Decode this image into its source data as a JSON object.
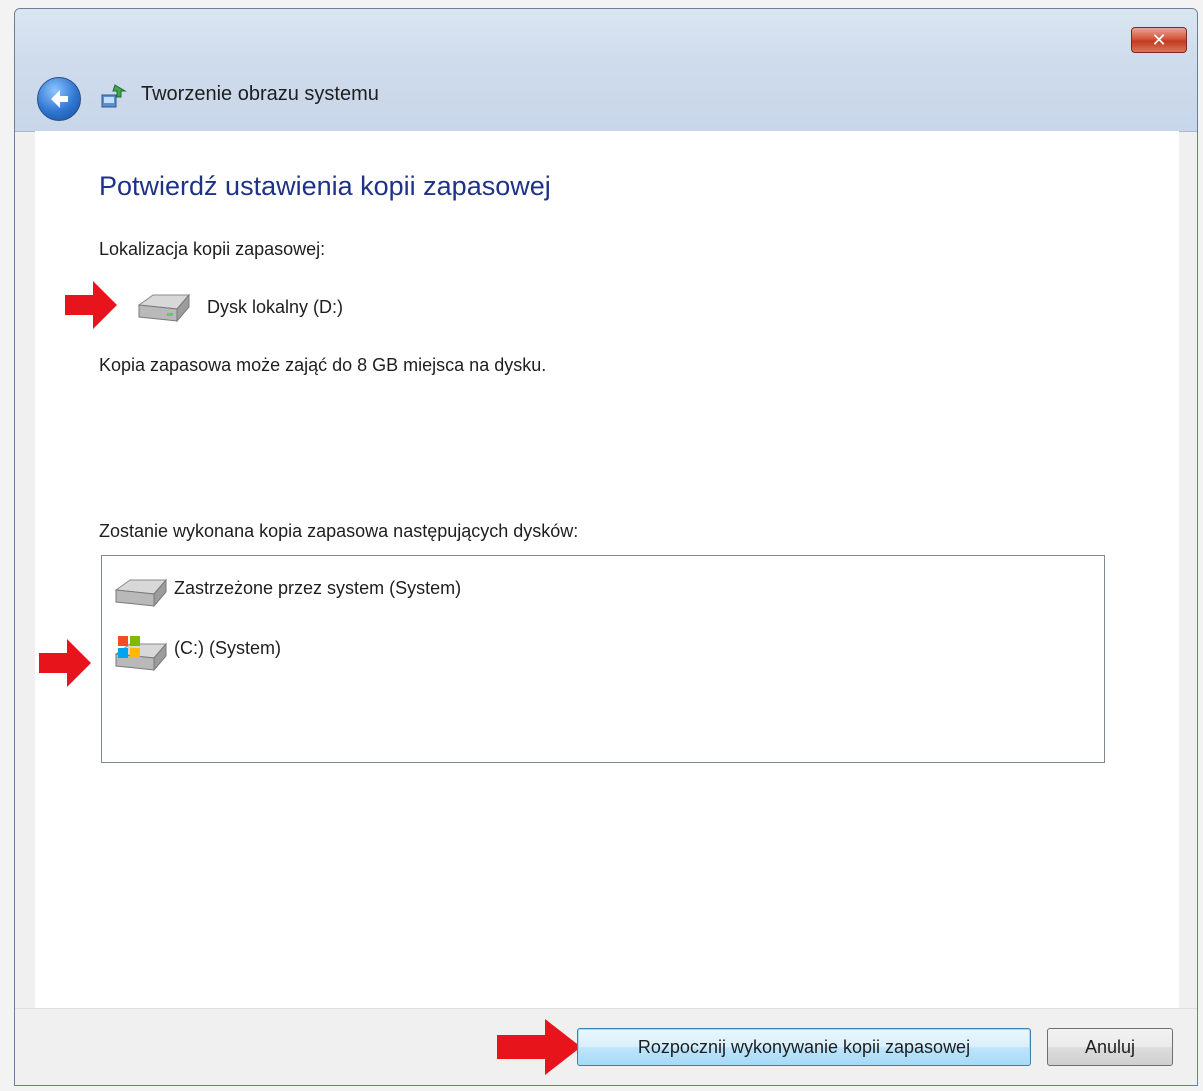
{
  "window": {
    "title": "Tworzenie obrazu systemu",
    "close_label": "✕"
  },
  "page": {
    "heading": "Potwierdź ustawienia kopii zapasowej",
    "location_label": "Lokalizacja kopii zapasowej:",
    "location_drive": "Dysk lokalny (D:)",
    "space_note": "Kopia zapasowa może zająć do 8 GB miejsca na dysku.",
    "drives_label": "Zostanie wykonana kopia zapasowa następujących dysków:",
    "drives": [
      {
        "label": "Zastrzeżone przez system (System)",
        "icon": "hard-drive-icon"
      },
      {
        "label": "(C:) (System)",
        "icon": "windows-drive-icon"
      }
    ]
  },
  "footer": {
    "start_label": "Rozpocznij wykonywanie kopii zapasowej",
    "cancel_label": "Anuluj"
  },
  "colors": {
    "heading": "#1e3287",
    "arrow": "#e8141b",
    "titlebar": "#cfdcec"
  }
}
